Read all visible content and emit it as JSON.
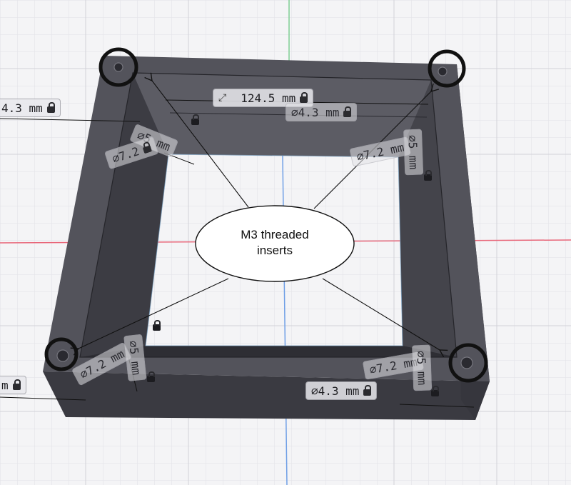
{
  "dimensions": {
    "left_width": "4.3 mm",
    "top_length": "124.5 mm",
    "top_hole_dia": "⌀4.3 mm",
    "tl_insert_dia": "⌀7.2",
    "tl_insert_depth": "⌀5 mm",
    "tr_insert_dia": "⌀7.2 mm",
    "tr_insert_depth": "⌀5 mm",
    "bl_insert_dia": "⌀7.2 mm",
    "bl_insert_depth": "⌀5 mm",
    "br_insert_dia": "⌀7.2 mm",
    "br_insert_depth": "⌀5 mm",
    "bottom_hole_dia": "⌀4.3 mm",
    "bottom_left_partial": "m"
  },
  "callout": {
    "line1": "M3 threaded",
    "line2": "inserts"
  },
  "icons": {
    "lock": "lock-icon",
    "resize": "resize-arrows-icon"
  },
  "colors": {
    "background": "#f4f4f6",
    "grid": "#d6d6dc",
    "part_top": "#505058",
    "part_side": "#3f3f46",
    "axis_red": "#e8677a",
    "axis_blue": "#6f9fe6",
    "axis_green": "#7fcf93",
    "highlight_circle": "#111111"
  }
}
